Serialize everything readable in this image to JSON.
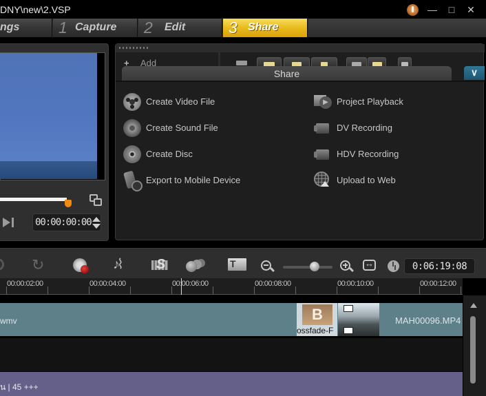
{
  "window": {
    "title": "DNY\\new\\2.VSP",
    "app_icon": "reel-menu-icon",
    "controls": {
      "minimize": "—",
      "maximize": "□",
      "close": "✕"
    }
  },
  "steps": [
    {
      "label": "ngs"
    },
    {
      "num": "1",
      "label": "Capture"
    },
    {
      "num": "2",
      "label": "Edit"
    },
    {
      "num": "3",
      "label": "Share",
      "active": true
    }
  ],
  "colors": {
    "active_step": "#e7b81a",
    "scrub_handle": "#f08a10",
    "video_track": "#5d8089",
    "title_track": "#646089",
    "collapse_button": "#2f7896"
  },
  "preview": {
    "timecode": "00:00:00:00",
    "scrub_progress_percent": 100
  },
  "library": {
    "add_label": "Add",
    "toolbar": [
      "folder",
      "video-filter",
      "photo-filter",
      "audio-filter",
      "list-view",
      "thumbnail-view",
      "title-options"
    ]
  },
  "share": {
    "title": "Share",
    "items_left": [
      {
        "label": "Create Video File",
        "icon": "film-reel-icon"
      },
      {
        "label": "Create Sound File",
        "icon": "sound-file-icon"
      },
      {
        "label": "Create Disc",
        "icon": "disc-icon"
      },
      {
        "label": "Export to Mobile Device",
        "icon": "mobile-device-icon"
      }
    ],
    "items_right": [
      {
        "label": "Project Playback",
        "icon": "playback-icon"
      },
      {
        "label": "DV Recording",
        "icon": "camcorder-icon"
      },
      {
        "label": "HDV Recording",
        "icon": "camcorder-icon"
      },
      {
        "label": "Upload to Web",
        "icon": "globe-upload-icon"
      }
    ]
  },
  "timeline": {
    "toolbar": {
      "redo_glyph": "↻",
      "audio_glyph": "♪⌇",
      "zoom_level_percent": 55,
      "project_duration": "0:06:19:08"
    },
    "ruler_labels": [
      "00:00:02:00",
      "00:00:04:00",
      "00:00:06:00",
      "00:00:08:00",
      "00:00:10:00",
      "00:00:12:00"
    ],
    "tracks": {
      "video_clip_left": "wmv",
      "transition_label": "ossfade-F",
      "video_clip_right": "MAH00096.MP4",
      "title_clip": "น | 45 +++"
    }
  }
}
